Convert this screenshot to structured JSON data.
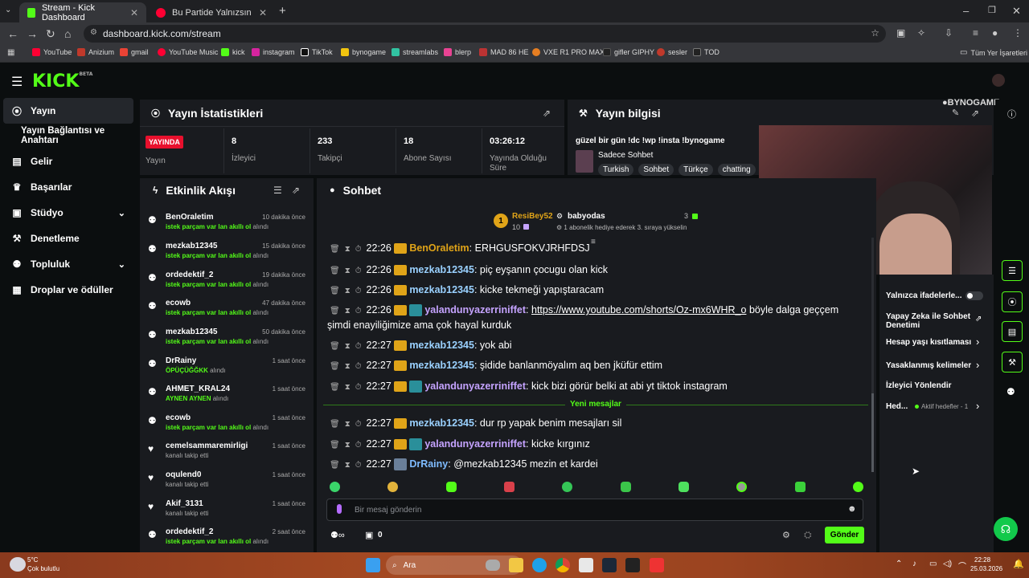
{
  "browser": {
    "tabs": [
      {
        "title": "Stream - Kick Dashboard",
        "active": true
      },
      {
        "title": "Bu Partide Yalnızsın | YouTu",
        "active": false
      }
    ],
    "url": "dashboard.kick.com/stream",
    "bookmarks": [
      "YouTube",
      "Anizium",
      "gmail",
      "YouTube Music",
      "kick",
      "instagram",
      "TikTok",
      "bynogame",
      "streamlabs",
      "blerp",
      "MAD 86 HE",
      "VXE R1 PRO MAX",
      "gifler GIPHY",
      "sesler",
      "TOD"
    ],
    "all_bookmarks": "Tüm Yer İşaretleri"
  },
  "sidebar": {
    "items": [
      {
        "label": "Yayın",
        "icon": "broadcast-icon",
        "active": true
      },
      {
        "label": "Yayın Bağlantısı ve Anahtarı",
        "icon": "",
        "active": false
      },
      {
        "label": "Gelir",
        "icon": "revenue-icon",
        "active": false
      },
      {
        "label": "Başarılar",
        "icon": "trophy-icon",
        "active": false
      },
      {
        "label": "Stüdyo",
        "icon": "studio-icon",
        "active": false,
        "chevron": true
      },
      {
        "label": "Denetleme",
        "icon": "wrench-icon",
        "active": false
      },
      {
        "label": "Topluluk",
        "icon": "community-icon",
        "active": false,
        "chevron": true
      },
      {
        "label": "Droplar ve ödüller",
        "icon": "gift-icon",
        "active": false
      }
    ]
  },
  "stats": {
    "title": "Yayın İstatistikleri",
    "live_badge": "YAYINDA",
    "live_label": "Yayın",
    "items": [
      {
        "value": "8",
        "label": "İzleyici"
      },
      {
        "value": "233",
        "label": "Takipçi"
      },
      {
        "value": "18",
        "label": "Abone Sayısı"
      },
      {
        "value": "03:26:12",
        "label": "Yayında Olduğu Süre"
      }
    ]
  },
  "stream_info": {
    "title": "Yayın bilgisi",
    "stream_title": "güzel bir gün !dc !wp !insta !bynogame",
    "category": "Sadece Sohbet",
    "tags": [
      "Turkish",
      "Sohbet",
      "Türkçe",
      "chatting"
    ]
  },
  "activity": {
    "title": "Etkinlik Akışı",
    "items": [
      {
        "name": "BenOraletim",
        "time": "10 dakika önce",
        "action": "istek parçam var lan akıllı ol",
        "suffix": "alındı",
        "icon": "redeem-icon"
      },
      {
        "name": "mezkab12345",
        "time": "15 dakika önce",
        "action": "istek parçam var lan akıllı ol",
        "suffix": "alındı",
        "icon": "redeem-icon"
      },
      {
        "name": "ordedektif_2",
        "time": "19 dakika önce",
        "action": "istek parçam var lan akıllı ol",
        "suffix": "alındı",
        "icon": "redeem-icon"
      },
      {
        "name": "ecowb",
        "time": "47 dakika önce",
        "action": "istek parçam var lan akıllı ol",
        "suffix": "alındı",
        "icon": "redeem-icon"
      },
      {
        "name": "mezkab12345",
        "time": "50 dakika önce",
        "action": "istek parçam var lan akıllı ol",
        "suffix": "alındı",
        "icon": "redeem-icon"
      },
      {
        "name": "DrRainy",
        "time": "1 saat önce",
        "action": "ÖPÜÇÜĞĞKK",
        "suffix": "alındı",
        "icon": "redeem-icon"
      },
      {
        "name": "AHMET_KRAL24",
        "time": "1 saat önce",
        "action": "AYNEN AYNEN",
        "suffix": "alındı",
        "icon": "redeem-icon"
      },
      {
        "name": "ecowb",
        "time": "1 saat önce",
        "action": "istek parçam var lan akıllı ol",
        "suffix": "alındı",
        "icon": "redeem-icon"
      },
      {
        "name": "cemelsammaremirligi",
        "time": "1 saat önce",
        "action": "",
        "suffix": "kanalı takip etti",
        "icon": "heart-icon"
      },
      {
        "name": "oqulend0",
        "time": "1 saat önce",
        "action": "",
        "suffix": "kanalı takip etti",
        "icon": "heart-icon"
      },
      {
        "name": "Akif_3131",
        "time": "1 saat önce",
        "action": "",
        "suffix": "kanalı takip etti",
        "icon": "heart-icon"
      },
      {
        "name": "ordedektif_2",
        "time": "2 saat önce",
        "action": "istek parçam var lan akıllı ol",
        "suffix": "alındı",
        "icon": "redeem-icon"
      }
    ]
  },
  "chat": {
    "title": "Sohbet",
    "leader": {
      "rank": "1",
      "name": "ResiBey52",
      "count": "10"
    },
    "gifter": {
      "name": "babyodas",
      "count": "3",
      "note": "1 abonelik hediye ederek 3. sıraya yükselin"
    },
    "messages": [
      {
        "time": "22:26",
        "user": "BenOraletim",
        "text": "ERHGUSFOKVJRHFDSJ",
        "ucls": "u1",
        "badge": "badge",
        "partial": true
      },
      {
        "time": "22:26",
        "user": "mezkab12345",
        "text": "piç eyşanın çocugu olan kick",
        "ucls": "u1",
        "badge": "badge"
      },
      {
        "time": "22:26",
        "user": "mezkab12345",
        "text": "kicke tekmeği yapıştaracam",
        "ucls": "u1",
        "badge": "badge"
      },
      {
        "time": "22:26",
        "user": "yalandunyazerriniffet",
        "link": "https://www.youtube.com/shorts/Oz-mx6WHR_o",
        "text": "böyle dalga geççem",
        "cont": "şimdi enayiliğimize ama çok hayal kurduk",
        "ucls": "u2",
        "badge": "badge2"
      },
      {
        "time": "22:27",
        "user": "mezkab12345",
        "text": "yok abi",
        "ucls": "u1",
        "badge": "badge"
      },
      {
        "time": "22:27",
        "user": "mezkab12345",
        "text": "şidide banlanmöyalım aq ben jküfür ettim",
        "ucls": "u1",
        "badge": "badge"
      },
      {
        "time": "22:27",
        "user": "yalandunyazerriniffet",
        "text": "kick bizi görür belki at abi yt tiktok instagram",
        "ucls": "u2",
        "badge": "badge2"
      },
      {
        "time": "22:27",
        "user": "mezkab12345",
        "text": "dur rp yapak benim mesajları sil",
        "ucls": "u1",
        "badge": "badge"
      },
      {
        "time": "22:27",
        "user": "yalandunyazerriniffet",
        "text": "kicke kırgınız",
        "ucls": "u2",
        "badge": "badge2"
      },
      {
        "time": "22:27",
        "user": "DrRainy",
        "text": "@mezkab12345 mezin et kardei",
        "ucls": "u3",
        "badge": "avatar"
      }
    ],
    "new_messages": "Yeni mesajlar",
    "input_placeholder": "Bir mesaj gönderin",
    "points": "0",
    "send": "Gönder"
  },
  "settings": {
    "items": [
      {
        "label": "Yalnızca ifadelerle...",
        "type": "toggle"
      },
      {
        "label": "Yapay Zeka ile Sohbet Denetimi",
        "type": "external"
      },
      {
        "label": "Hesap yaşı kısıtlaması",
        "type": "chevron"
      },
      {
        "label": "Yasaklanmış kelimeler",
        "type": "chevron"
      },
      {
        "label": "İzleyici Yönlendir",
        "type": "none"
      },
      {
        "label": "Hed...",
        "type": "chevron",
        "extra": "Aktif hedefler - 1"
      }
    ]
  },
  "taskbar": {
    "weather_temp": "5°C",
    "weather_desc": "Çok bulutlu",
    "search": "Ara",
    "time": "22:28",
    "date": "25.03.2026"
  },
  "colors": {
    "accent": "#53fc18",
    "panel": "#191b1f",
    "bg": "#0b0e0f"
  }
}
